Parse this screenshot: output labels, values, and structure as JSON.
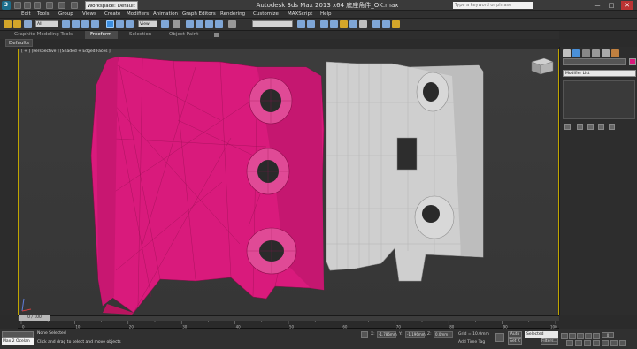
{
  "window": {
    "app_logo": "3",
    "title": "Autodesk 3ds Max  2013 x64      底座角件_OK.max",
    "workspace": "Workspace: Default",
    "search_placeholder": "Type a keyword or phrase"
  },
  "menu": [
    "Edit",
    "Tools",
    "Group",
    "Views",
    "Create",
    "Modifiers",
    "Animation",
    "Graph Editors",
    "Rendering",
    "Customize",
    "MAXScript",
    "Help"
  ],
  "toolbar": {
    "selection_filter": "All",
    "reference_coord": "View"
  },
  "ribbon": {
    "tabs": [
      "Graphite Modeling Tools",
      "Freeform",
      "Selection",
      "Object Paint"
    ],
    "active_tab": "Freeform",
    "panel_label": "Defaults"
  },
  "viewport": {
    "label": "[ + ] [Perspective ] [Shaded + Edged Faces ]"
  },
  "command_panel": {
    "modifier_list": "Modifier List"
  },
  "timeline": {
    "frame_display": "0 / 100",
    "ticks": [
      "0",
      "10",
      "20",
      "30",
      "40",
      "50",
      "60",
      "70",
      "80",
      "90",
      "100"
    ],
    "current_frame": "0"
  },
  "status": {
    "maxscript": "Max 2 Ocelan",
    "selection": "None Selected",
    "prompt": "Click and drag to select and move objects",
    "x_label": "X:",
    "y_label": "Y:",
    "z_label": "Z:",
    "x_value": "-1.786mm",
    "y_value": "-1.196mm",
    "z_value": "0.0mm",
    "grid": "Grid = 10.0mm",
    "add_time_tag": "Add Time Tag",
    "auto_key": "Auto",
    "set_key": "Set K",
    "key_filter": "Selected",
    "filters": "Filters..."
  },
  "colors": {
    "pink_object": "#d91a7c",
    "grey_object": "#c9c9c9",
    "viewport_border": "#bfa400"
  }
}
